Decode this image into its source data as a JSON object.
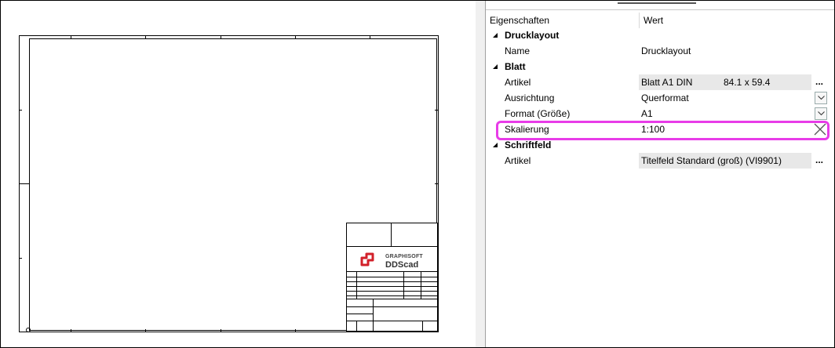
{
  "preview": {
    "logo": {
      "line1": "GRAPHISOFT",
      "line2": "DDScad"
    },
    "colors": {
      "logo_red": "#d2202a"
    }
  },
  "properties": {
    "headers": {
      "property": "Eigenschaften",
      "value": "Wert"
    },
    "sections": [
      {
        "title": "Drucklayout",
        "rows": [
          {
            "label": "Name",
            "value": "Drucklayout"
          }
        ]
      },
      {
        "title": "Blatt",
        "rows": [
          {
            "label": "Artikel",
            "value": "Blatt A1 DIN",
            "value2": "84.1 x 59.4",
            "button": "..."
          },
          {
            "label": "Ausrichtung",
            "value": "Querformat",
            "control": "dropdown"
          },
          {
            "label": "Format (Größe)",
            "value": "A1",
            "control": "dropdown"
          },
          {
            "label": "Skalierung",
            "value": "1:100",
            "control": "clear"
          }
        ]
      },
      {
        "title": "Schriftfeld",
        "rows": [
          {
            "label": "Artikel",
            "value": "Titelfeld Standard (groß) (VI9901)",
            "button": "..."
          }
        ]
      }
    ],
    "highlight_color": "#e83ce8"
  }
}
